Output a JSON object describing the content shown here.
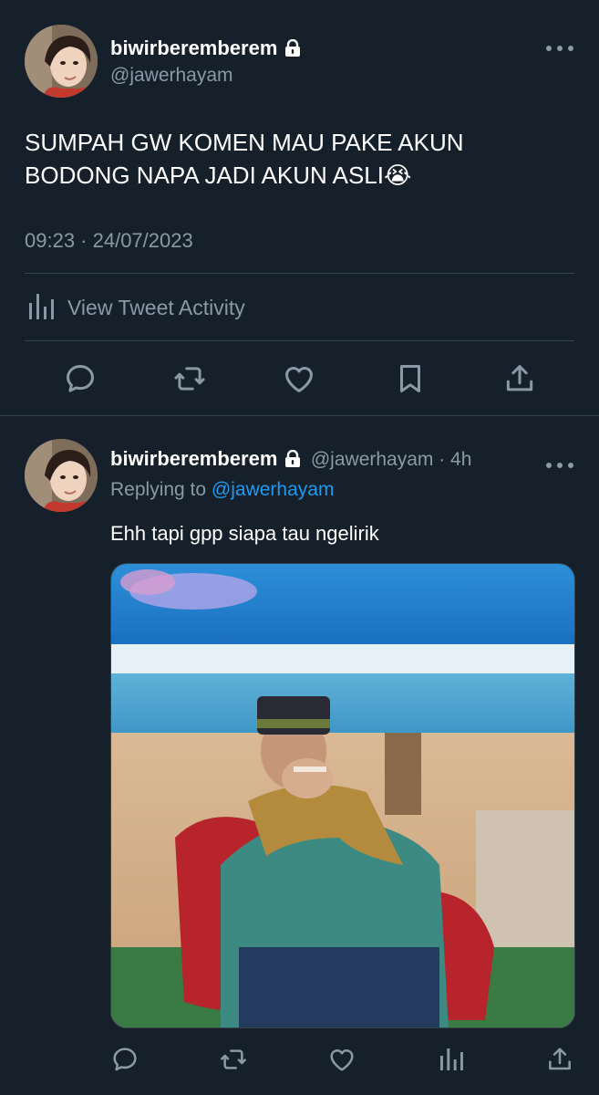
{
  "main_tweet": {
    "display_name": "biwirberemberem",
    "handle": "@jawerhayam",
    "text_line1": "SUMPAH GW KOMEN MAU PAKE AKUN",
    "text_line2": "BODONG NAPA JADI AKUN ASLI",
    "emoji": "😭",
    "timestamp": "09:23 · 24/07/2023",
    "activity_label": "View Tweet Activity"
  },
  "reply_tweet": {
    "display_name": "biwirberemberem",
    "handle_time": "@jawerhayam · 4h",
    "replying_prefix": "Replying to ",
    "replying_handle": "@jawerhayam",
    "text": "Ehh tapi gpp siapa tau ngelirik"
  },
  "colors": {
    "background": "#15202b",
    "muted": "#8b98a5",
    "accent": "#1d9bf0",
    "divider": "#38444d"
  },
  "icons": [
    "lock-icon",
    "more-icon",
    "reply-icon",
    "retweet-icon",
    "like-icon",
    "bookmark-icon",
    "share-icon",
    "analytics-icon"
  ]
}
